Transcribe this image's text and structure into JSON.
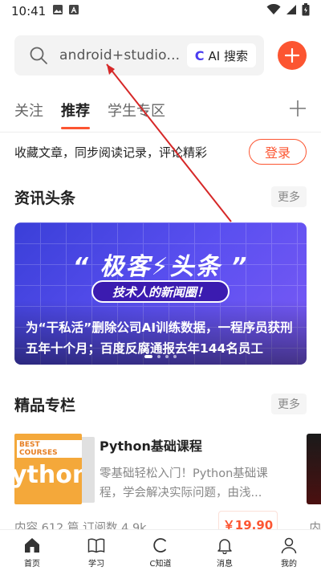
{
  "status_bar": {
    "time": "10:41"
  },
  "search": {
    "query": "android+studio...",
    "ai_prefix": "C",
    "ai_button": "AI 搜索"
  },
  "tabs": [
    {
      "label": "关注",
      "active": false
    },
    {
      "label": "推荐",
      "active": true
    },
    {
      "label": "学生专区",
      "active": false
    }
  ],
  "login_prompt": {
    "text": "收藏文章，同步阅读记录，评论精彩",
    "button": "登录"
  },
  "news_section": {
    "title": "资讯头条",
    "more": "更多",
    "banner": {
      "brand": "“ 极客⚡头条 ”",
      "slogan": "技术人的新闻圈！",
      "headline": "为“干私活”删除公司AI训练数据，一程序员获刑五年十个月；百度反腐通报去年144名员工"
    }
  },
  "column_section": {
    "title": "精品专栏",
    "more": "更多",
    "course": {
      "cover_badge": "BEST COURSES",
      "cover_text": "ython",
      "title": "Python基础课程",
      "description": "零基础轻松入门！Python基础课程，学会解决实际问题，由浅...",
      "meta": "内容 612 篇 订阅数 4.9k",
      "price": "￥19.90",
      "meta_next": "内"
    }
  },
  "bottom_nav": [
    {
      "label": "首页",
      "icon": "home-icon"
    },
    {
      "label": "学习",
      "icon": "book-icon"
    },
    {
      "label": "C知道",
      "icon": "c-icon"
    },
    {
      "label": "消息",
      "icon": "bell-icon"
    },
    {
      "label": "我的",
      "icon": "person-icon"
    }
  ],
  "colors": {
    "accent": "#fc5531",
    "ai_brand": "#4a3cf0",
    "banner": "#4b47e6"
  }
}
